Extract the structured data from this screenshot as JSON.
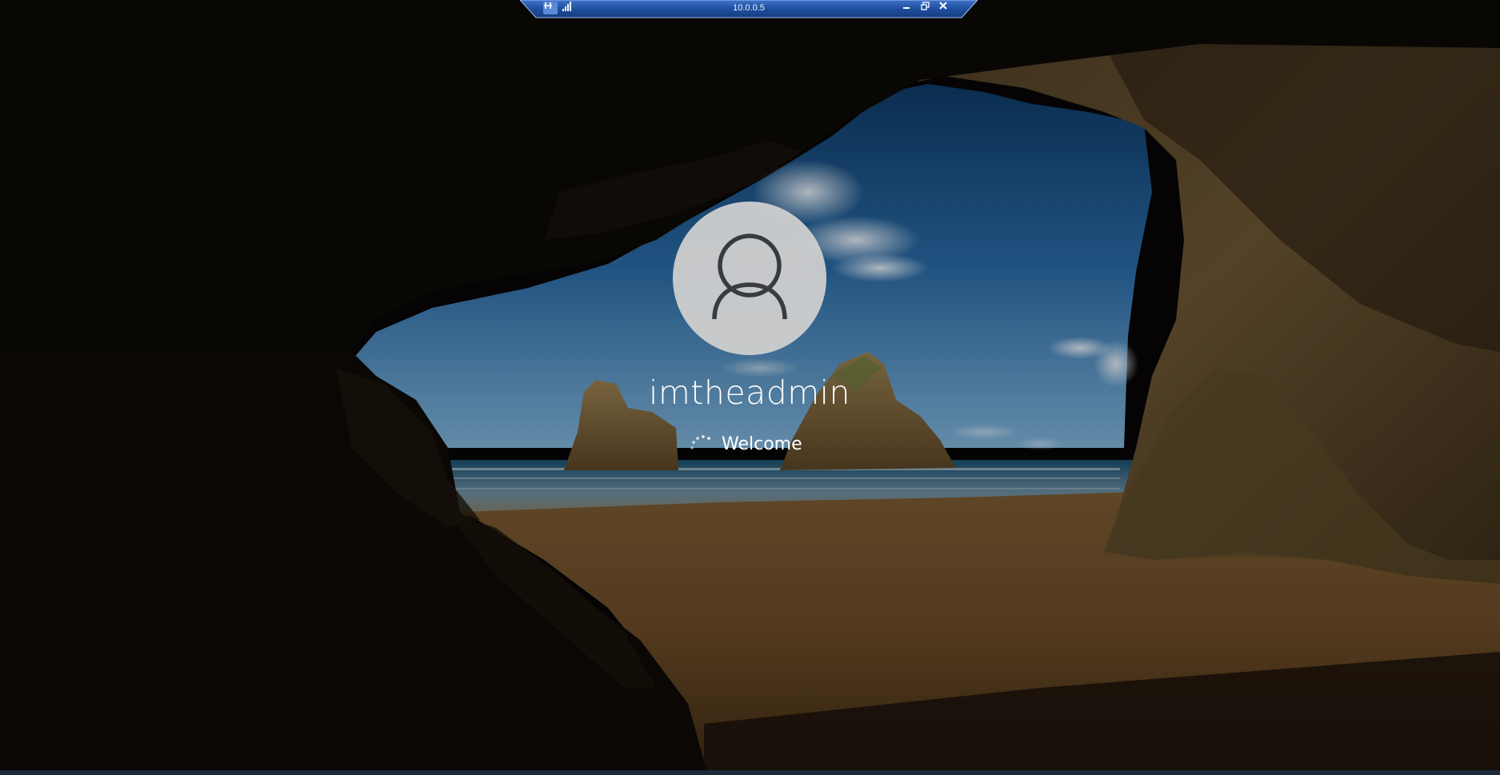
{
  "rdp_bar": {
    "title": "10.0.0.5",
    "pin_icon": "pin-icon",
    "signal_icon": "signal-bars-icon",
    "minimize_icon": "minimize-icon",
    "restore_icon": "restore-icon",
    "close_icon": "close-icon"
  },
  "login": {
    "username": "imtheadmin",
    "status": "Welcome",
    "avatar_icon": "user-icon",
    "spinner_icon": "loading-spinner-icon"
  },
  "colors": {
    "rdp_bar": "#1f4fa0",
    "avatar_bg": "#cfcfcf",
    "text": "#ffffff"
  }
}
